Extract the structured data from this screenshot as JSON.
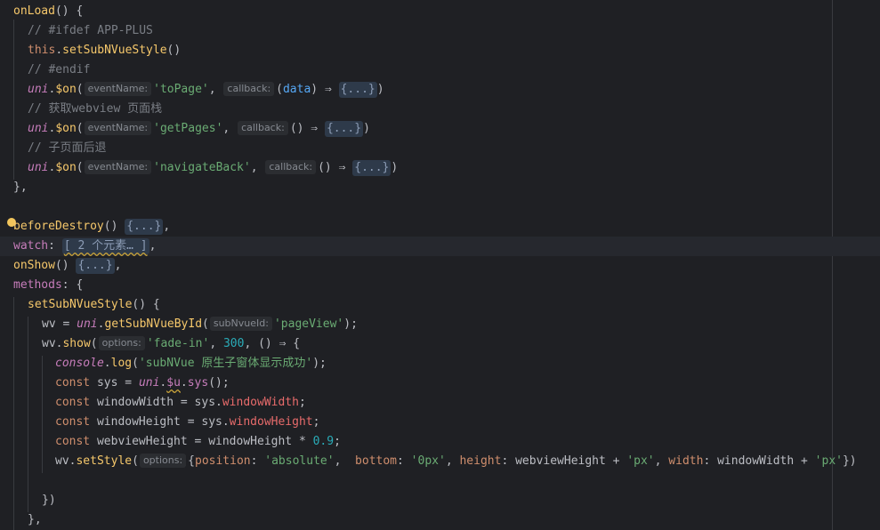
{
  "code": {
    "on_load": "onLoad",
    "ifdef": "// #ifdef APP-PLUS",
    "this_kw": "this",
    "set_sub_nvue_style": "setSubNVueStyle",
    "endif": "// #endif",
    "uni": "uni",
    "on": "$on",
    "hint_event_name": "eventName:",
    "hint_callback": "callback:",
    "hint_sub_nvue_id": "subNvueId:",
    "hint_options": "options:",
    "str_to_page": "'toPage'",
    "data_param": "data",
    "fold_braces": "{...}",
    "comment_get_pages": "// 获取webview 页面栈",
    "str_get_pages": "'getPages'",
    "comment_navigate_back": "// 子页面后退",
    "str_navigate_back": "'navigateBack'",
    "before_destroy": "beforeDestroy",
    "watch": "watch",
    "watch_fold": "[ 2 个元素… ]",
    "on_show": "onShow",
    "methods": "methods",
    "wv": "wv",
    "get_sub_nvue_by_id": "getSubNVueById",
    "str_page_view": "'pageView'",
    "show": "show",
    "str_fade_in": "'fade-in'",
    "num_300": "300",
    "console": "console",
    "log": "log",
    "str_log": "'subNVue 原生子窗体显示成功'",
    "const_kw": "const",
    "sys": "sys",
    "u_dollar": "$u",
    "sys_prop": "sys",
    "window_width": "windowWidth",
    "window_height": "windowHeight",
    "webview_height": "webviewHeight",
    "num_09": "0.9",
    "set_style": "setStyle",
    "position_key": "position",
    "str_absolute": "'absolute'",
    "bottom_key": "bottom",
    "str_0px": "'0px'",
    "height_key": "height",
    "str_px": "'px'",
    "width_key": "width"
  }
}
